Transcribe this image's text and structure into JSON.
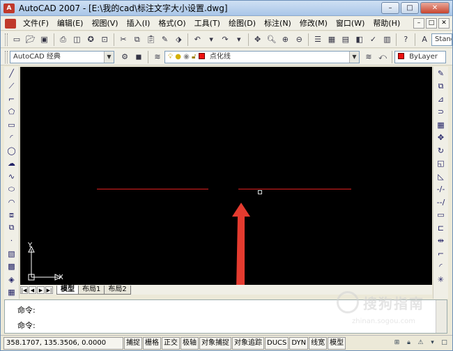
{
  "window": {
    "title": "AutoCAD 2007 - [E:\\我的cad\\标注文字大小设置.dwg]",
    "app_icon_label": "A",
    "buttons": {
      "minimize": "–",
      "maximize": "□",
      "close": "✕"
    }
  },
  "menu": {
    "items": [
      "文件(F)",
      "编辑(E)",
      "视图(V)",
      "插入(I)",
      "格式(O)",
      "工具(T)",
      "绘图(D)",
      "标注(N)",
      "修改(M)",
      "窗口(W)",
      "帮助(H)"
    ],
    "right_buttons": [
      "–",
      "□",
      "✕"
    ]
  },
  "toolbar1": {
    "style_combo": "Stand"
  },
  "toolbar2": {
    "workspace": "AutoCAD 经典",
    "layer": "点化线",
    "color": "ByLayer",
    "layer_color": "#e11111"
  },
  "drawing": {
    "background": "#000000",
    "line_color": "#e02020",
    "ucs_x_label": "X",
    "ucs_y_label": "Y"
  },
  "tabs": {
    "nav": [
      "|◀",
      "◀",
      "▶",
      "▶|"
    ],
    "items": [
      {
        "label": "模型",
        "active": true
      },
      {
        "label": "布局1",
        "active": false
      },
      {
        "label": "布局2",
        "active": false
      }
    ]
  },
  "command": {
    "line1": "命令:",
    "line2": "命令:"
  },
  "status": {
    "coords": "358.1707, 135.3506, 0.0000",
    "buttons": [
      "捕捉",
      "栅格",
      "正交",
      "极轴",
      "对象捕捉",
      "对象追踪",
      "DUCS",
      "DYN",
      "线宽",
      "模型"
    ]
  },
  "watermark": {
    "text": "搜狗指南",
    "url": "zhinan.sogou.com"
  }
}
